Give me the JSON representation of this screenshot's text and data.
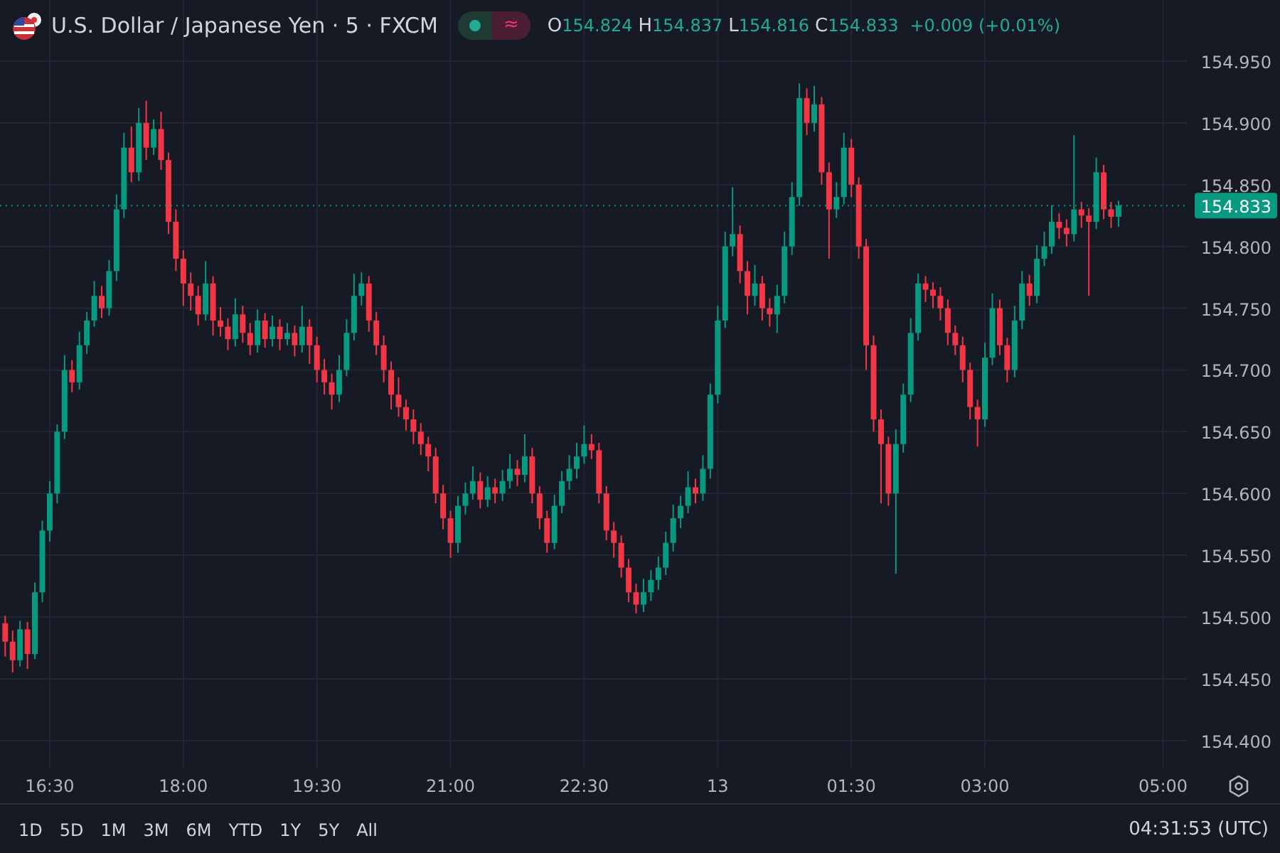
{
  "legend": {
    "title": "U.S. Dollar / Japanese Yen · 5 · FXCM",
    "market_open": true,
    "indicator_glyph": "≈",
    "ohlc": [
      {
        "label": "O",
        "value": "154.824"
      },
      {
        "label": "H",
        "value": "154.837"
      },
      {
        "label": "L",
        "value": "154.816"
      },
      {
        "label": "C",
        "value": "154.833"
      }
    ],
    "change": "+0.009 (+0.01%)"
  },
  "chart": {
    "chart_data": {
      "type": "candlestick",
      "grid": true,
      "ref_lines": [
        {
          "axis": "y",
          "value": 154.833,
          "label": "154.833",
          "color": "#089981"
        }
      ],
      "ylim": [
        154.378,
        154.9995
      ],
      "categories": [
        null,
        null,
        null,
        null,
        null,
        null,
        "16:30",
        null,
        null,
        null,
        null,
        null,
        null,
        null,
        null,
        null,
        null,
        null,
        null,
        null,
        null,
        null,
        null,
        null,
        "18:00",
        null,
        null,
        null,
        null,
        null,
        null,
        null,
        null,
        null,
        null,
        null,
        null,
        null,
        null,
        null,
        null,
        null,
        "19:30",
        null,
        null,
        null,
        null,
        null,
        null,
        null,
        null,
        null,
        null,
        null,
        null,
        null,
        null,
        null,
        null,
        null,
        "21:00",
        null,
        null,
        null,
        null,
        null,
        null,
        null,
        null,
        null,
        null,
        null,
        null,
        null,
        null,
        null,
        null,
        null,
        "22:30",
        null,
        null,
        null,
        null,
        null,
        null,
        null,
        null,
        null,
        null,
        null,
        null,
        null,
        null,
        null,
        null,
        null,
        "13",
        null,
        null,
        null,
        null,
        null,
        null,
        null,
        null,
        null,
        null,
        null,
        null,
        null,
        null,
        null,
        null,
        null,
        "01:30",
        null,
        null,
        null,
        null,
        null,
        null,
        null,
        null,
        null,
        null,
        null,
        null,
        null,
        null,
        null,
        null,
        null,
        "03:00",
        null,
        null,
        null,
        null,
        null,
        null,
        null,
        null,
        null,
        null,
        null,
        null,
        null,
        null,
        null,
        null,
        null,
        null,
        null,
        null,
        null,
        null,
        null,
        "05:00"
      ],
      "yticks": [
        {
          "value": 154.95,
          "label": "154.950"
        },
        {
          "value": 154.9,
          "label": "154.900"
        },
        {
          "value": 154.85,
          "label": "154.850"
        },
        {
          "value": 154.8,
          "label": "154.800"
        },
        {
          "value": 154.75,
          "label": "154.750"
        },
        {
          "value": 154.7,
          "label": "154.700"
        },
        {
          "value": 154.65,
          "label": "154.650"
        },
        {
          "value": 154.6,
          "label": "154.600"
        },
        {
          "value": 154.55,
          "label": "154.550"
        },
        {
          "value": 154.5,
          "label": "154.500"
        },
        {
          "value": 154.45,
          "label": "154.450"
        },
        {
          "value": 154.4,
          "label": "154.400"
        }
      ],
      "ohlc": [
        [
          154.495,
          154.501,
          154.468,
          154.48
        ],
        [
          154.48,
          154.489,
          154.455,
          154.465
        ],
        [
          154.465,
          154.497,
          154.46,
          154.49
        ],
        [
          154.49,
          154.496,
          154.458,
          154.47
        ],
        [
          154.47,
          154.528,
          154.466,
          154.52
        ],
        [
          154.52,
          154.578,
          154.512,
          154.57
        ],
        [
          154.57,
          154.61,
          154.561,
          154.6
        ],
        [
          154.6,
          154.656,
          154.592,
          154.65
        ],
        [
          154.65,
          154.712,
          154.644,
          154.7
        ],
        [
          154.7,
          154.708,
          154.682,
          154.69
        ],
        [
          154.69,
          154.731,
          154.684,
          154.72
        ],
        [
          154.72,
          154.747,
          154.713,
          154.74
        ],
        [
          154.74,
          154.772,
          154.735,
          154.76
        ],
        [
          154.76,
          154.768,
          154.742,
          154.75
        ],
        [
          154.75,
          154.789,
          154.744,
          154.78
        ],
        [
          154.78,
          154.842,
          154.772,
          154.83
        ],
        [
          154.83,
          154.892,
          154.823,
          154.88
        ],
        [
          154.88,
          154.897,
          154.852,
          154.86
        ],
        [
          154.86,
          154.912,
          154.853,
          154.9
        ],
        [
          154.9,
          154.918,
          154.87,
          154.88
        ],
        [
          154.88,
          154.903,
          154.874,
          154.895
        ],
        [
          154.895,
          154.909,
          154.862,
          154.87
        ],
        [
          154.87,
          154.876,
          154.81,
          154.82
        ],
        [
          154.82,
          154.83,
          154.78,
          154.79
        ],
        [
          154.79,
          154.797,
          154.752,
          154.77
        ],
        [
          154.77,
          154.779,
          154.748,
          154.76
        ],
        [
          154.76,
          154.768,
          154.736,
          154.745
        ],
        [
          154.745,
          154.788,
          154.74,
          154.77
        ],
        [
          154.77,
          154.776,
          154.728,
          154.74
        ],
        [
          154.74,
          154.751,
          154.727,
          154.735
        ],
        [
          154.735,
          154.742,
          154.716,
          154.725
        ],
        [
          154.725,
          154.758,
          154.719,
          154.745
        ],
        [
          154.745,
          154.752,
          154.722,
          154.73
        ],
        [
          154.73,
          154.738,
          154.712,
          154.72
        ],
        [
          154.72,
          154.749,
          154.714,
          154.74
        ],
        [
          154.74,
          154.746,
          154.718,
          154.725
        ],
        [
          154.725,
          154.744,
          154.719,
          154.735
        ],
        [
          154.735,
          154.741,
          154.716,
          154.725
        ],
        [
          154.725,
          154.738,
          154.72,
          154.73
        ],
        [
          154.73,
          154.736,
          154.711,
          154.72
        ],
        [
          154.72,
          154.752,
          154.714,
          154.735
        ],
        [
          154.735,
          154.741,
          154.705,
          154.72
        ],
        [
          154.72,
          154.727,
          154.69,
          154.7
        ],
        [
          154.7,
          154.709,
          154.68,
          154.69
        ],
        [
          154.69,
          154.697,
          154.668,
          154.68
        ],
        [
          154.68,
          154.712,
          154.674,
          154.7
        ],
        [
          154.7,
          154.741,
          154.695,
          154.73
        ],
        [
          154.73,
          154.778,
          154.724,
          154.76
        ],
        [
          154.76,
          154.779,
          154.752,
          154.77
        ],
        [
          154.77,
          154.776,
          154.731,
          154.74
        ],
        [
          154.74,
          154.747,
          154.712,
          154.72
        ],
        [
          154.72,
          154.728,
          154.69,
          154.7
        ],
        [
          154.7,
          154.707,
          154.668,
          154.68
        ],
        [
          154.68,
          154.694,
          154.662,
          154.67
        ],
        [
          154.67,
          154.676,
          154.651,
          154.66
        ],
        [
          154.66,
          154.668,
          154.64,
          154.65
        ],
        [
          154.65,
          154.657,
          154.631,
          154.64
        ],
        [
          154.64,
          154.646,
          154.618,
          154.63
        ],
        [
          154.63,
          154.637,
          154.592,
          154.6
        ],
        [
          154.6,
          154.607,
          154.571,
          154.58
        ],
        [
          154.58,
          154.586,
          154.548,
          154.56
        ],
        [
          154.56,
          154.598,
          154.552,
          154.59
        ],
        [
          154.59,
          154.609,
          154.583,
          154.6
        ],
        [
          154.6,
          154.622,
          154.595,
          154.61
        ],
        [
          154.61,
          154.617,
          154.588,
          154.595
        ],
        [
          154.595,
          154.614,
          154.589,
          154.605
        ],
        [
          154.605,
          154.612,
          154.592,
          154.6
        ],
        [
          154.6,
          154.619,
          154.594,
          154.61
        ],
        [
          154.61,
          154.632,
          154.604,
          154.62
        ],
        [
          154.62,
          154.627,
          154.606,
          154.615
        ],
        [
          154.615,
          154.648,
          154.609,
          154.63
        ],
        [
          154.63,
          154.637,
          154.592,
          154.6
        ],
        [
          154.6,
          154.606,
          154.571,
          154.58
        ],
        [
          154.58,
          154.586,
          154.552,
          154.56
        ],
        [
          154.56,
          154.599,
          154.555,
          154.59
        ],
        [
          154.59,
          154.618,
          154.584,
          154.61
        ],
        [
          154.61,
          154.631,
          154.603,
          154.62
        ],
        [
          154.62,
          154.641,
          154.612,
          154.63
        ],
        [
          154.63,
          154.655,
          154.624,
          154.64
        ],
        [
          154.64,
          154.648,
          154.628,
          154.635
        ],
        [
          154.635,
          154.641,
          154.592,
          154.6
        ],
        [
          154.6,
          154.606,
          154.562,
          154.57
        ],
        [
          154.57,
          154.577,
          154.548,
          154.56
        ],
        [
          154.56,
          154.566,
          154.532,
          154.54
        ],
        [
          154.54,
          154.547,
          154.512,
          154.52
        ],
        [
          154.52,
          154.527,
          154.503,
          154.51
        ],
        [
          154.51,
          154.531,
          154.504,
          154.52
        ],
        [
          154.52,
          154.538,
          154.513,
          154.53
        ],
        [
          154.53,
          154.549,
          154.522,
          154.54
        ],
        [
          154.54,
          154.569,
          154.534,
          154.56
        ],
        [
          154.56,
          154.591,
          154.553,
          154.58
        ],
        [
          154.58,
          154.598,
          154.572,
          154.59
        ],
        [
          154.59,
          154.618,
          154.584,
          154.605
        ],
        [
          154.605,
          154.612,
          154.592,
          154.6
        ],
        [
          154.6,
          154.631,
          154.594,
          154.62
        ],
        [
          154.62,
          154.689,
          154.612,
          154.68
        ],
        [
          154.68,
          154.752,
          154.673,
          154.74
        ],
        [
          154.74,
          154.812,
          154.734,
          154.8
        ],
        [
          154.8,
          154.848,
          154.792,
          154.81
        ],
        [
          154.81,
          154.817,
          154.77,
          154.78
        ],
        [
          154.78,
          154.788,
          154.745,
          154.76
        ],
        [
          154.76,
          154.785,
          154.752,
          154.77
        ],
        [
          154.77,
          154.776,
          154.74,
          154.75
        ],
        [
          154.75,
          154.758,
          154.735,
          154.745
        ],
        [
          154.745,
          154.769,
          154.73,
          154.76
        ],
        [
          154.76,
          154.812,
          154.754,
          154.8
        ],
        [
          154.8,
          154.852,
          154.793,
          154.84
        ],
        [
          154.84,
          154.932,
          154.833,
          154.92
        ],
        [
          154.92,
          154.928,
          154.89,
          154.9
        ],
        [
          154.9,
          154.93,
          154.893,
          154.915
        ],
        [
          154.915,
          154.921,
          154.85,
          154.86
        ],
        [
          154.86,
          154.868,
          154.79,
          154.83
        ],
        [
          154.83,
          154.852,
          154.823,
          154.84
        ],
        [
          154.84,
          154.892,
          154.834,
          154.88
        ],
        [
          154.88,
          154.887,
          154.84,
          154.85
        ],
        [
          154.85,
          154.856,
          154.79,
          154.8
        ],
        [
          154.8,
          154.806,
          154.7,
          154.72
        ],
        [
          154.72,
          154.728,
          154.65,
          154.66
        ],
        [
          154.66,
          154.668,
          154.592,
          154.64
        ],
        [
          154.64,
          154.646,
          154.59,
          154.6
        ],
        [
          154.6,
          154.652,
          154.535,
          154.64
        ],
        [
          154.64,
          154.689,
          154.633,
          154.68
        ],
        [
          154.68,
          154.742,
          154.674,
          154.73
        ],
        [
          154.73,
          154.778,
          154.724,
          154.77
        ],
        [
          154.77,
          154.776,
          154.755,
          154.765
        ],
        [
          154.765,
          154.771,
          154.75,
          154.76
        ],
        [
          154.76,
          154.767,
          154.74,
          154.75
        ],
        [
          154.75,
          154.757,
          154.72,
          154.73
        ],
        [
          154.73,
          154.736,
          154.712,
          154.72
        ],
        [
          154.72,
          154.727,
          154.69,
          154.7
        ],
        [
          154.7,
          154.706,
          154.66,
          154.67
        ],
        [
          154.67,
          154.676,
          154.638,
          154.66
        ],
        [
          154.66,
          154.722,
          154.654,
          154.71
        ],
        [
          154.71,
          154.762,
          154.704,
          154.75
        ],
        [
          154.75,
          154.757,
          154.712,
          154.72
        ],
        [
          154.72,
          154.726,
          154.69,
          154.7
        ],
        [
          154.7,
          154.752,
          154.694,
          154.74
        ],
        [
          154.74,
          154.78,
          154.733,
          154.77
        ],
        [
          154.77,
          154.777,
          154.752,
          154.76
        ],
        [
          154.76,
          154.801,
          154.754,
          154.79
        ],
        [
          154.79,
          154.812,
          154.784,
          154.8
        ],
        [
          154.8,
          154.833,
          154.794,
          154.82
        ],
        [
          154.82,
          154.827,
          154.806,
          154.815
        ],
        [
          154.815,
          154.822,
          154.8,
          154.81
        ],
        [
          154.81,
          154.89,
          154.804,
          154.83
        ],
        [
          154.83,
          154.836,
          154.815,
          154.825
        ],
        [
          154.825,
          154.831,
          154.76,
          154.82
        ],
        [
          154.82,
          154.872,
          154.814,
          154.86
        ],
        [
          154.86,
          154.866,
          154.822,
          154.83
        ],
        [
          154.83,
          154.836,
          154.815,
          154.824
        ],
        [
          154.824,
          154.837,
          154.816,
          154.833
        ],
        null,
        null,
        null,
        null,
        null,
        null
      ]
    }
  },
  "ranges": [
    "1D",
    "5D",
    "1M",
    "3M",
    "6M",
    "YTD",
    "1Y",
    "5Y",
    "All"
  ],
  "clock": "04:31:53 (UTC)"
}
